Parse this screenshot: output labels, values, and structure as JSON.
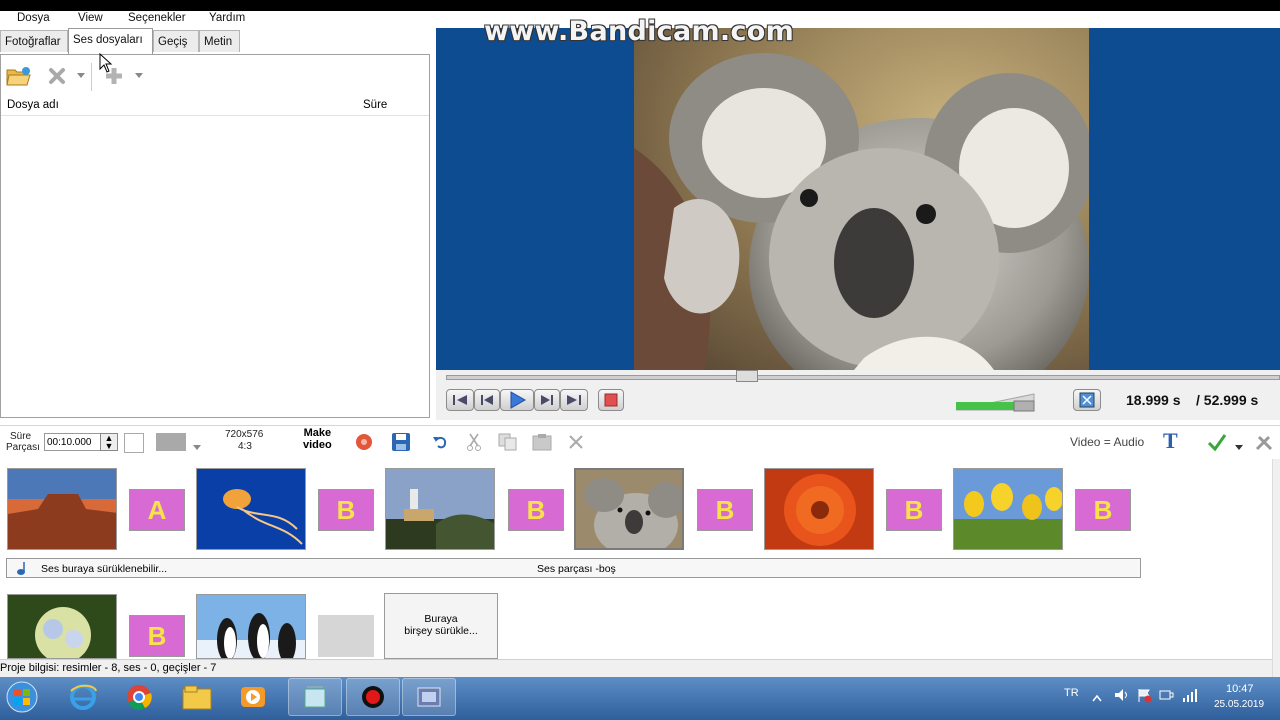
{
  "watermark": "www.Bandicam.com",
  "menu": {
    "items": [
      "Dosya",
      "View",
      "Seçenekler",
      "Yardım"
    ]
  },
  "tabs": {
    "items": [
      "Fotoğraflar",
      "Ses dosyaları",
      "Geçiş",
      "Metin"
    ],
    "active": "Ses dosyaları"
  },
  "file_list": {
    "col_name": "Dosya adı",
    "col_duration": "Süre"
  },
  "player": {
    "current_time": "18.999 s",
    "total_time": "/ 52.999 s",
    "seek_position": 0.36,
    "volume_level": 0.8
  },
  "toolbar": {
    "duration_label_1": "Süre",
    "duration_label_2": "Parçası",
    "duration_value": "00:10.000",
    "resolution": "720x576",
    "aspect": "4:3",
    "make_video_1": "Make",
    "make_video_2": "video",
    "video_audio": "Video = Audio"
  },
  "timeline": {
    "audio_drop_hint": "Ses buraya sürüklenebilir...",
    "audio_track_label": "Ses parçası -boş",
    "drop_hint_1": "Buraya",
    "drop_hint_2": "birşey sürükle...",
    "transition_letter": "A",
    "transition_letter_b": "B"
  },
  "status": {
    "text": "Proje bilgisi: resimler - 8, ses - 0, geçişler - 7"
  },
  "taskbar": {
    "language": "TR",
    "time": "10:47",
    "date": "25.05.2019"
  },
  "colors": {
    "preview_bg": "#0d4c91",
    "transition_pink": "#d86ad4",
    "taskbar": "#3a6ea8",
    "stop_red": "#e05050"
  }
}
